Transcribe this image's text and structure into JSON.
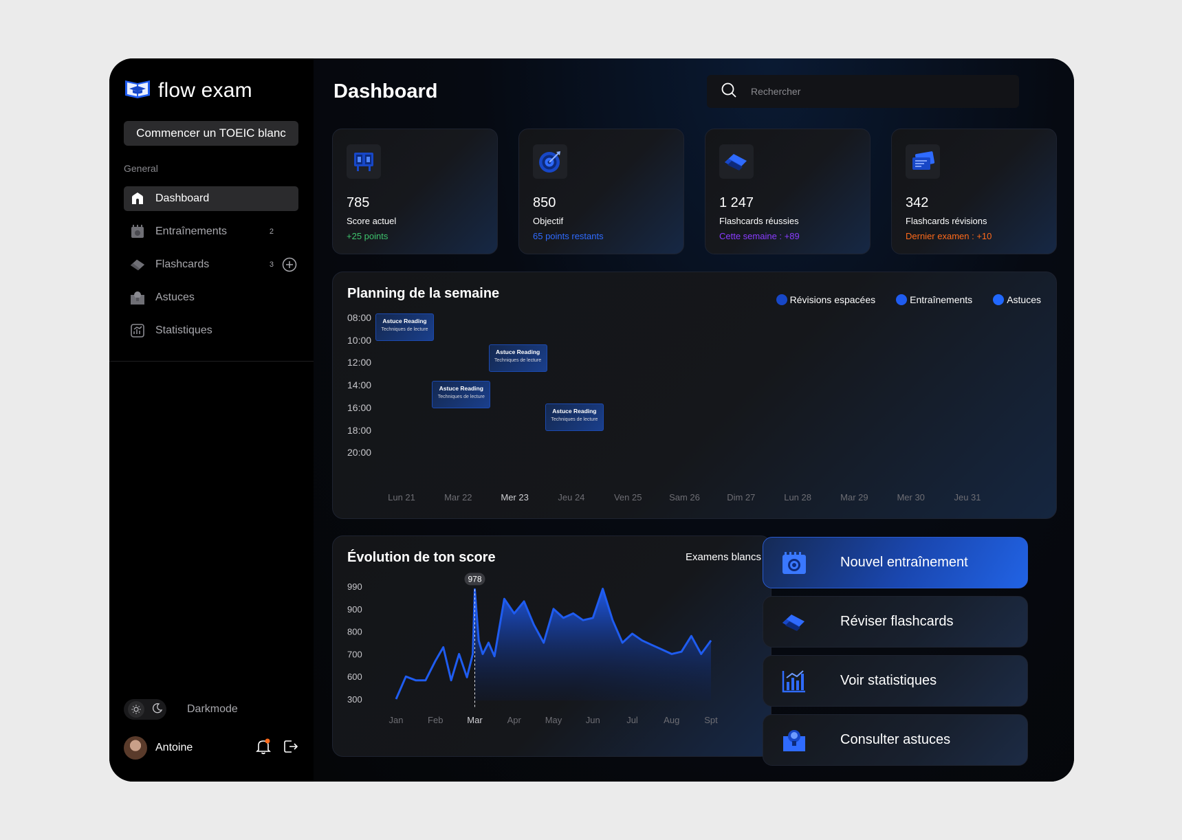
{
  "brand": {
    "name": "flow exam"
  },
  "sidebar": {
    "cta_label": "Commencer un TOEIC blanc",
    "section_label": "General",
    "items": [
      {
        "label": "Dashboard",
        "icon": "home-icon",
        "count": ""
      },
      {
        "label": "Entraînements",
        "icon": "notebook-icon",
        "count": "2"
      },
      {
        "label": "Flashcards",
        "icon": "cards-icon",
        "count": "3"
      },
      {
        "label": "Astuces",
        "icon": "lightbulb-icon",
        "count": ""
      },
      {
        "label": "Statistiques",
        "icon": "chart-icon",
        "count": ""
      }
    ],
    "theme_label": "Darkmode",
    "user_name": "Antoine"
  },
  "header": {
    "title": "Dashboard",
    "search_placeholder": "Rechercher"
  },
  "stats": [
    {
      "value": "785",
      "label": "Score actuel",
      "sub": "+25 points",
      "sub_color": "#3ec46d",
      "icon": "score-board-icon"
    },
    {
      "value": "850",
      "label": "Objectif",
      "sub": "65 points restants",
      "sub_color": "#2f6bff",
      "icon": "target-icon"
    },
    {
      "value": "1 247",
      "label": "Flashcards réussies",
      "sub": "Cette semaine : +89",
      "sub_color": "#8a3cff",
      "icon": "cards-icon"
    },
    {
      "value": "342",
      "label": "Flashcards révisions",
      "sub": "Dernier examen : +10",
      "sub_color": "#ff6a1a",
      "icon": "card-revision-icon"
    }
  ],
  "planning": {
    "title": "Planning de la semaine",
    "legend": [
      {
        "label": "Révisions espacées",
        "color": "#1747c7"
      },
      {
        "label": "Entraînements",
        "color": "#1f5cf0"
      },
      {
        "label": "Astuces",
        "color": "#2168ff"
      }
    ],
    "times": [
      "08:00",
      "10:00",
      "12:00",
      "14:00",
      "16:00",
      "18:00",
      "20:00"
    ],
    "days": [
      "Lun 21",
      "Mar 22",
      "Mer 23",
      "Jeu 24",
      "Ven 25",
      "Sam 26",
      "Dim 27",
      "Lun 28",
      "Mar 29",
      "Mer 30",
      "Jeu 31"
    ],
    "today": "Mer 23",
    "events": [
      {
        "title": "Astuce Reading",
        "subtitle": "Techniques de lecture",
        "day": "Lun 21",
        "start": "08:00"
      },
      {
        "title": "Astuce Reading",
        "subtitle": "Techniques de lecture",
        "day": "Mer 23",
        "start": "10:45"
      },
      {
        "title": "Astuce Reading",
        "subtitle": "Techniques de lecture",
        "day": "Mar 22",
        "start": "14:00"
      },
      {
        "title": "Astuce Reading",
        "subtitle": "Techniques de lecture",
        "day": "Jeu 24",
        "start": "16:00"
      }
    ]
  },
  "chart_data": {
    "type": "area",
    "title": "Évolution de ton score",
    "filter": "Examens blancs",
    "y_ticks": [
      "990",
      "900",
      "800",
      "700",
      "600",
      "300"
    ],
    "x_ticks": [
      "Jan",
      "Feb",
      "Mar",
      "Apr",
      "May",
      "Jun",
      "Jul",
      "Aug",
      "Spt"
    ],
    "highlight": {
      "x": 2.0,
      "value": "978",
      "label": "Mar"
    },
    "series": [
      {
        "points": [
          [
            0.0,
            300
          ],
          [
            0.25,
            600
          ],
          [
            0.5,
            550
          ],
          [
            0.75,
            550
          ],
          [
            1.0,
            670
          ],
          [
            1.2,
            730
          ],
          [
            1.4,
            550
          ],
          [
            1.6,
            700
          ],
          [
            1.8,
            590
          ],
          [
            1.95,
            700
          ],
          [
            2.0,
            978
          ],
          [
            2.1,
            760
          ],
          [
            2.2,
            700
          ],
          [
            2.35,
            750
          ],
          [
            2.5,
            690
          ],
          [
            2.75,
            940
          ],
          [
            3.0,
            880
          ],
          [
            3.25,
            930
          ],
          [
            3.5,
            830
          ],
          [
            3.75,
            750
          ],
          [
            4.0,
            900
          ],
          [
            4.25,
            860
          ],
          [
            4.5,
            880
          ],
          [
            4.75,
            850
          ],
          [
            5.0,
            860
          ],
          [
            5.25,
            980
          ],
          [
            5.5,
            850
          ],
          [
            5.75,
            750
          ],
          [
            6.0,
            790
          ],
          [
            6.25,
            760
          ],
          [
            6.5,
            740
          ],
          [
            6.75,
            720
          ],
          [
            7.0,
            700
          ],
          [
            7.25,
            710
          ],
          [
            7.5,
            780
          ],
          [
            7.75,
            700
          ],
          [
            8.0,
            760
          ]
        ]
      }
    ]
  },
  "actions": [
    {
      "label": "Nouvel entraînement",
      "icon": "notebook-target-icon"
    },
    {
      "label": "Réviser flashcards",
      "icon": "cards-icon"
    },
    {
      "label": "Voir statistiques",
      "icon": "bar-chart-icon"
    },
    {
      "label": "Consulter astuces",
      "icon": "lightbulb-icon"
    }
  ],
  "colors": {
    "accent": "#1f5cf0",
    "panel": "#141518"
  }
}
